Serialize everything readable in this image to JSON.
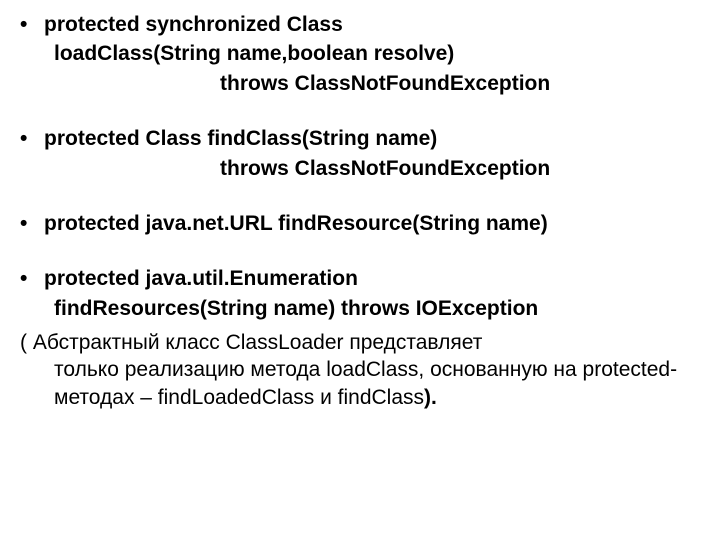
{
  "items": [
    {
      "l1": "protected synchronized Class",
      "l2": "loadClass(String name,boolean resolve)",
      "l3": "throws ClassNotFoundException"
    },
    {
      "l1": "protected Class findClass(String name)",
      "l3": "throws ClassNotFoundException"
    },
    {
      "l1": "protected java.net.URL findResource(String name)"
    },
    {
      "l1": "protected java.util.Enumeration",
      "l2": "findResources(String name) throws IOException"
    }
  ],
  "paragraph": {
    "start": "( Абстрактный класс ClassLoader представляет",
    "cont": "только реализацию метода loadClass, основанную на protected-методах – findLoadedClass и findClass",
    "end": ")."
  }
}
